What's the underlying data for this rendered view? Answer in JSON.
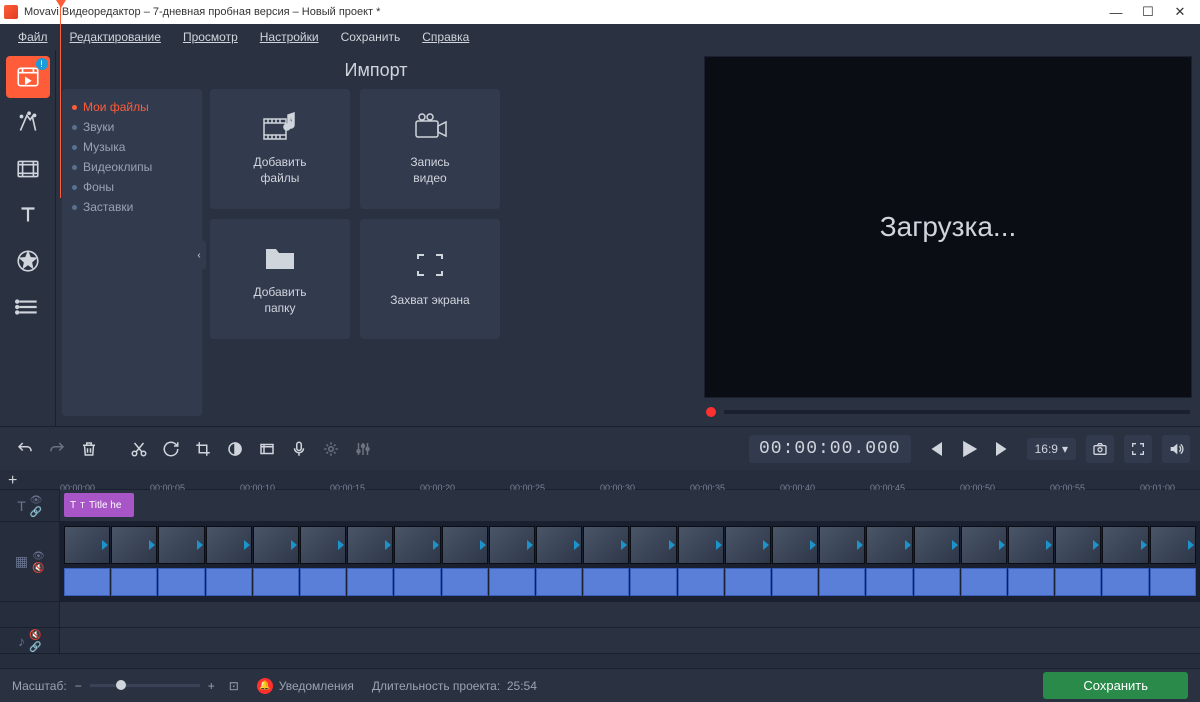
{
  "titlebar": {
    "title": "Movavi Видеоредактор – 7-дневная пробная версия – Новый проект *"
  },
  "menu": {
    "file": "Файл",
    "edit": "Редактирование",
    "view": "Просмотр",
    "settings": "Настройки",
    "save": "Сохранить",
    "help": "Справка"
  },
  "import": {
    "title": "Импорт",
    "categories": [
      {
        "label": "Мои файлы",
        "active": true
      },
      {
        "label": "Звуки"
      },
      {
        "label": "Музыка"
      },
      {
        "label": "Видеоклипы"
      },
      {
        "label": "Фоны"
      },
      {
        "label": "Заставки"
      }
    ],
    "tiles": {
      "add_files": "Добавить\nфайлы",
      "record_video": "Запись\nвидео",
      "add_folder": "Добавить\nпапку",
      "capture_screen": "Захват экрана"
    }
  },
  "preview": {
    "loading": "Загрузка..."
  },
  "player": {
    "timecode": "00:00:00.000",
    "ratio": "16:9"
  },
  "timeline": {
    "ticks": [
      "00:00:00",
      "00:00:05",
      "00:00:10",
      "00:00:15",
      "00:00:20",
      "00:00:25",
      "00:00:30",
      "00:00:35",
      "00:00:40",
      "00:00:45",
      "00:00:50",
      "00:00:55",
      "00:01:00"
    ],
    "title_clip": "Title he"
  },
  "bottom": {
    "zoom_label": "Масштаб:",
    "notifications": "Уведомления",
    "duration_label": "Длительность проекта:",
    "duration_value": "25:54",
    "save": "Сохранить"
  }
}
